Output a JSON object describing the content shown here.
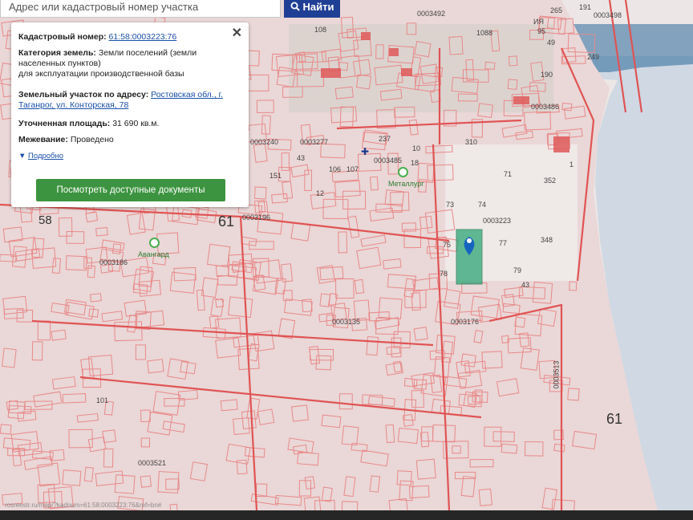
{
  "search": {
    "placeholder": "Адрес или кадастровый номер участка",
    "button_label": "Найти"
  },
  "popup": {
    "cadastral_label": "Кадастровый номер:",
    "cadastral_value": "61:58:0003223:76",
    "category_label": "Категория земель:",
    "category_value": "Земли поселений (земли населенных пунктов)",
    "purpose_value": "для эксплуатации производственной базы",
    "address_label": "Земельный участок по адресу:",
    "address_value": "Ростовская обл., г. Таганрог, ул. Конторская, 78",
    "area_label": "Уточненная площадь:",
    "area_value": "31 690 кв.м.",
    "survey_label": "Межевание:",
    "survey_value": "Проведено",
    "details_link": "Подробно",
    "docs_button": "Посмотреть доступные документы",
    "close": "✕"
  },
  "map": {
    "labels": [
      "0003492",
      "108",
      "1088",
      "265",
      "191",
      "0003498",
      "249",
      "95",
      "49",
      "ИЯ",
      "190",
      "0003486",
      "0003240",
      "0003277",
      "0003485",
      "310",
      "1",
      "73",
      "352",
      "0003196",
      "61",
      "58",
      "74",
      "0003223",
      "348",
      "71",
      "75",
      "77",
      "79",
      "78",
      "43",
      "0003186",
      "0003176",
      "0003135",
      "0003521",
      "0003513",
      "61",
      "106",
      "107",
      "12",
      "101",
      "237",
      "18",
      "10",
      "151",
      "43"
    ],
    "poi": [
      "Металлург",
      "Авангард"
    ],
    "region_number": "61",
    "accent": "#e53935",
    "highlight": "#2ea676"
  },
  "status_url": "rosreestr.ru/map/?kadnum=61:58:0003223:76&ref=bn#"
}
